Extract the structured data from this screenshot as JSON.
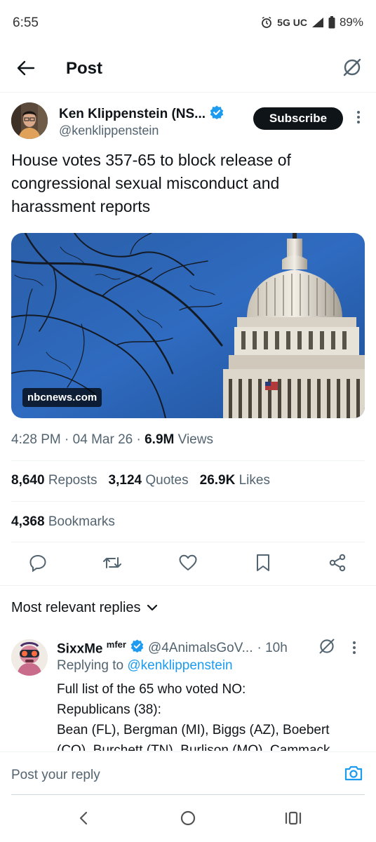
{
  "status_bar": {
    "time": "6:55",
    "network": "5G UC",
    "battery": "89%"
  },
  "header": {
    "title": "Post"
  },
  "author": {
    "name": "Ken Klippenstein (NS...",
    "handle": "@kenklippenstein",
    "subscribe_label": "Subscribe"
  },
  "tweet": {
    "text": "House votes 357-65 to block release of congressional sexual misconduct and harassment reports",
    "media_domain": "nbcnews.com",
    "time": "4:28 PM",
    "date": "04 Mar 26",
    "views_count": "6.9M",
    "views_label": "Views"
  },
  "stats": {
    "reposts_count": "8,640",
    "reposts_label": "Reposts",
    "quotes_count": "3,124",
    "quotes_label": "Quotes",
    "likes_count": "26.9K",
    "likes_label": "Likes",
    "bookmarks_count": "4,368",
    "bookmarks_label": "Bookmarks"
  },
  "replies_section": {
    "sort_label": "Most relevant replies"
  },
  "reply": {
    "name": "SixxMe",
    "name_sup": "mfer",
    "handle": "@4AnimalsGoV...",
    "time": "· 10h",
    "replying_prefix": "Replying to",
    "replying_handle": "@kenklippenstein",
    "line1": "Full list of the 65 who voted NO:",
    "line2": "Republicans (38):",
    "line3": "Bean (FL), Bergman (MI), Biggs (AZ), Boebert",
    "line4": "(CO), Burchett (TN), Burlison (MO), Cammack"
  },
  "compose": {
    "placeholder": "Post your reply"
  },
  "colors": {
    "accent": "#1d9bf0",
    "text": "#0f1419",
    "secondary": "#536471"
  }
}
